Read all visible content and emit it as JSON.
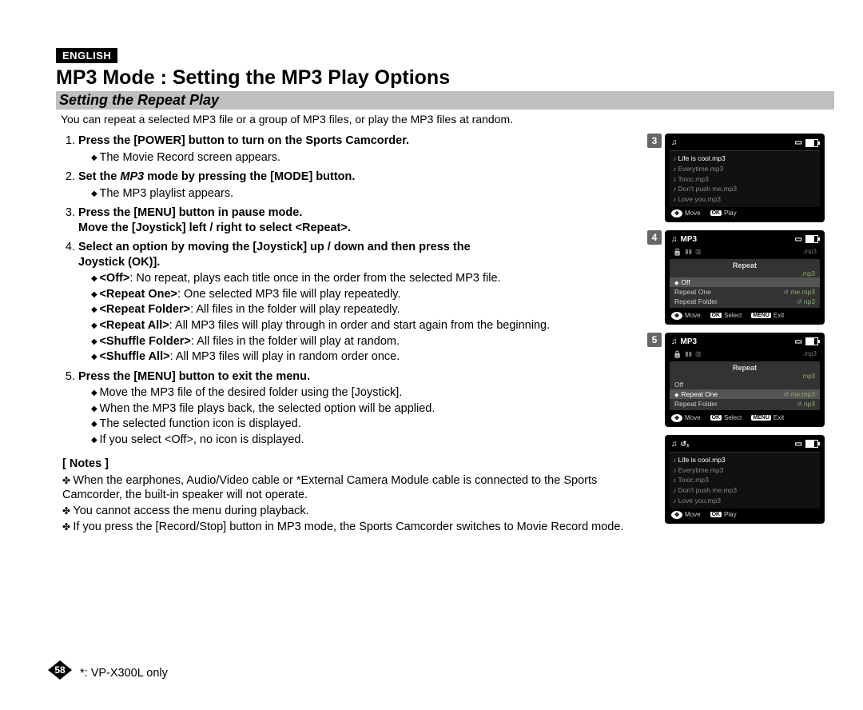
{
  "lang_badge": "ENGLISH",
  "main_title": "MP3 Mode : Setting the MP3 Play Options",
  "sub_title": "Setting the Repeat Play",
  "intro": "You can repeat a selected MP3 file or a group of MP3 files, or play the MP3 files at random.",
  "steps": {
    "s1": {
      "title": "Press the [POWER] button to turn on the Sports Camcorder.",
      "b1": "The Movie Record screen appears."
    },
    "s2": {
      "title_pre": "Set the ",
      "title_mp3": "MP3",
      "title_post": " mode by pressing the [MODE] button.",
      "b1": "The MP3 playlist appears."
    },
    "s3": {
      "title_l1": "Press the [MENU] button in pause mode.",
      "title_l2": "Move the [Joystick] left / right to select <Repeat>."
    },
    "s4": {
      "title_l1": "Select an option by moving the [Joystick] up / down and then press the",
      "title_l2": "Joystick (OK)].",
      "opts": {
        "o1_name": "<Off>",
        "o1_desc": ": No repeat, plays each title once in the order from the selected MP3 file.",
        "o2_name": "<Repeat One>",
        "o2_desc": ": One selected MP3 file will play repeatedly.",
        "o3_name": "<Repeat Folder>",
        "o3_desc": ": All files in the folder will play repeatedly.",
        "o4_name": "<Repeat All>",
        "o4_desc": ": All MP3 files will play through in order and start again from the beginning.",
        "o5_name": "<Shuffle Folder>",
        "o5_desc": ": All files in the folder will play at random.",
        "o6_name": "<Shuffle All>",
        "o6_desc": ": All MP3 files will play in random order once."
      }
    },
    "s5": {
      "title": "Press the [MENU] button to exit the menu.",
      "b1": "Move the MP3 file of the desired folder using the [Joystick].",
      "b2": "When the MP3 file plays back, the selected option will be applied.",
      "b3": "The selected function icon is displayed.",
      "b4": "If you select <Off>, no icon is displayed."
    }
  },
  "notes_title": "[ Notes ]",
  "notes": {
    "n1": "When the earphones, Audio/Video cable or *External Camera Module cable is connected to the Sports Camcorder, the built-in speaker will not operate.",
    "n2": "You cannot access the menu during playback.",
    "n3": "If you press the [Record/Stop] button in MP3 mode, the Sports Camcorder switches to Movie Record mode."
  },
  "page_num": "58",
  "footnote": "*: VP-X300L only",
  "screens": {
    "s3": {
      "num": "3",
      "tracks": [
        "Life is cool.mp3",
        "Everytime.mp3",
        "Toxic.mp3",
        "Don't push me.mp3",
        "Love you.mp3"
      ],
      "f_move": "Move",
      "f_play": "Play"
    },
    "s4": {
      "num": "4",
      "hdr": "MP3",
      "menu_title": "Repeat",
      "bg1": ".mp3",
      "bg2": ".mp3",
      "m1": "Off",
      "m2": "Repeat One",
      "m3": "Repeat Folder",
      "suffix": "mp3",
      "f_move": "Move",
      "f_sel": "Select",
      "f_exit": "Exit",
      "menu_key": "MENU"
    },
    "s5": {
      "num": "5",
      "hdr": "MP3",
      "menu_title": "Repeat",
      "bg1": ".mp3",
      "bg2": "mp3",
      "m1": "Off",
      "m2": "Repeat One",
      "m3": "Repeat Folder",
      "suffix_me": "me.mp3",
      "suffix_np": "np3",
      "f_move": "Move",
      "f_sel": "Select",
      "f_exit": "Exit",
      "menu_key": "MENU"
    },
    "s6": {
      "tracks": [
        "Life is cool.mp3",
        "Everytime.mp3",
        "Toxic.mp3",
        "Don't push me.mp3",
        "Love you.mp3"
      ],
      "f_move": "Move",
      "f_play": "Play"
    }
  }
}
